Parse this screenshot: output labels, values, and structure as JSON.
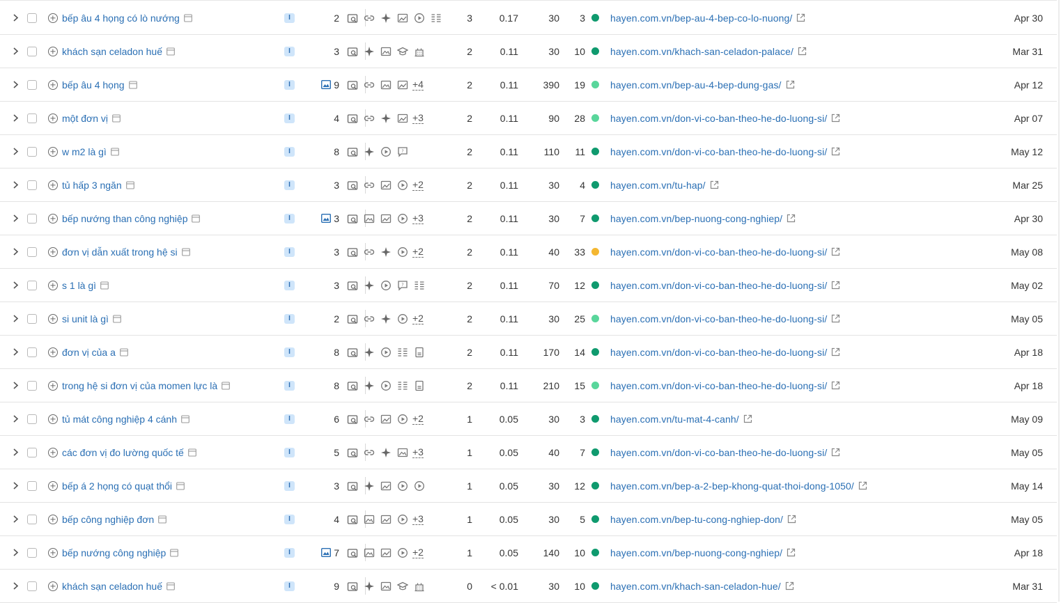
{
  "colors": {
    "kd_dark_green": "#0f9a6e",
    "kd_light_green": "#59d69b",
    "kd_yellow": "#f4b731",
    "link_blue": "#2a6fb4"
  },
  "intent_label": "I",
  "rows": [
    {
      "keyword": "bếp âu 4 họng có lò nướng",
      "image": false,
      "results": "2",
      "features": [
        "link",
        "magic",
        "image-check",
        "play",
        "list"
      ],
      "more": "",
      "volume": "3",
      "share": "0.17",
      "cpc": "30",
      "kd": "3",
      "kd_color": "#0f9a6e",
      "url": "hayen.com.vn/bep-au-4-bep-co-lo-nuong/",
      "date": "Apr 30"
    },
    {
      "keyword": "khách sạn celadon huế",
      "image": false,
      "results": "3",
      "features": [
        "magic",
        "image",
        "graduation",
        "hotel"
      ],
      "more": "",
      "volume": "2",
      "share": "0.11",
      "cpc": "30",
      "kd": "10",
      "kd_color": "#0f9a6e",
      "url": "hayen.com.vn/khach-san-celadon-palace/",
      "date": "Mar 31"
    },
    {
      "keyword": "bếp âu 4 họng",
      "image": true,
      "results": "9",
      "features": [
        "link",
        "image",
        "image-check"
      ],
      "more": "+4",
      "volume": "2",
      "share": "0.11",
      "cpc": "390",
      "kd": "19",
      "kd_color": "#59d69b",
      "url": "hayen.com.vn/bep-au-4-bep-dung-gas/",
      "date": "Apr 12"
    },
    {
      "keyword": "một đơn vị",
      "image": false,
      "results": "4",
      "features": [
        "link",
        "magic",
        "image-check"
      ],
      "more": "+3",
      "volume": "2",
      "share": "0.11",
      "cpc": "90",
      "kd": "28",
      "kd_color": "#59d69b",
      "url": "hayen.com.vn/don-vi-co-ban-theo-he-do-luong-si/",
      "date": "Apr 07"
    },
    {
      "keyword": "w m2 là gì",
      "image": false,
      "results": "8",
      "features": [
        "magic",
        "play",
        "question"
      ],
      "more": "",
      "volume": "2",
      "share": "0.11",
      "cpc": "110",
      "kd": "11",
      "kd_color": "#0f9a6e",
      "url": "hayen.com.vn/don-vi-co-ban-theo-he-do-luong-si/",
      "date": "May 12"
    },
    {
      "keyword": "tủ hấp 3 ngăn",
      "image": false,
      "results": "3",
      "features": [
        "link",
        "image-check",
        "play"
      ],
      "more": "+2",
      "volume": "2",
      "share": "0.11",
      "cpc": "30",
      "kd": "4",
      "kd_color": "#0f9a6e",
      "url": "hayen.com.vn/tu-hap/",
      "date": "Mar 25"
    },
    {
      "keyword": "bếp nướng than công nghiệp",
      "image": true,
      "results": "3",
      "features": [
        "image",
        "image-check",
        "play"
      ],
      "more": "+3",
      "volume": "2",
      "share": "0.11",
      "cpc": "30",
      "kd": "7",
      "kd_color": "#0f9a6e",
      "url": "hayen.com.vn/bep-nuong-cong-nghiep/",
      "date": "Apr 30"
    },
    {
      "keyword": "đơn vị dẫn xuất trong hệ si",
      "image": false,
      "results": "3",
      "features": [
        "link",
        "magic",
        "play"
      ],
      "more": "+2",
      "volume": "2",
      "share": "0.11",
      "cpc": "40",
      "kd": "33",
      "kd_color": "#f4b731",
      "url": "hayen.com.vn/don-vi-co-ban-theo-he-do-luong-si/",
      "date": "May 08"
    },
    {
      "keyword": "s 1 là gì",
      "image": false,
      "results": "3",
      "features": [
        "magic",
        "play",
        "question",
        "list"
      ],
      "more": "",
      "volume": "2",
      "share": "0.11",
      "cpc": "70",
      "kd": "12",
      "kd_color": "#0f9a6e",
      "url": "hayen.com.vn/don-vi-co-ban-theo-he-do-luong-si/",
      "date": "May 02"
    },
    {
      "keyword": "si unit là gì",
      "image": false,
      "results": "2",
      "features": [
        "link",
        "magic",
        "play"
      ],
      "more": "+2",
      "volume": "2",
      "share": "0.11",
      "cpc": "30",
      "kd": "25",
      "kd_color": "#59d69b",
      "url": "hayen.com.vn/don-vi-co-ban-theo-he-do-luong-si/",
      "date": "May 05"
    },
    {
      "keyword": "đơn vị của a",
      "image": false,
      "results": "8",
      "features": [
        "magic",
        "play",
        "list",
        "doc"
      ],
      "more": "",
      "volume": "2",
      "share": "0.11",
      "cpc": "170",
      "kd": "14",
      "kd_color": "#0f9a6e",
      "url": "hayen.com.vn/don-vi-co-ban-theo-he-do-luong-si/",
      "date": "Apr 18"
    },
    {
      "keyword": "trong hệ si đơn vị của momen lực là",
      "image": false,
      "results": "8",
      "features": [
        "magic",
        "play",
        "list",
        "doc"
      ],
      "more": "",
      "volume": "2",
      "share": "0.11",
      "cpc": "210",
      "kd": "15",
      "kd_color": "#59d69b",
      "url": "hayen.com.vn/don-vi-co-ban-theo-he-do-luong-si/",
      "date": "Apr 18"
    },
    {
      "keyword": "tủ mát công nghiệp 4 cánh",
      "image": false,
      "results": "6",
      "features": [
        "link",
        "image-check",
        "play"
      ],
      "more": "+2",
      "volume": "1",
      "share": "0.05",
      "cpc": "30",
      "kd": "3",
      "kd_color": "#0f9a6e",
      "url": "hayen.com.vn/tu-mat-4-canh/",
      "date": "May 09"
    },
    {
      "keyword": "các đơn vị đo lường quốc tế",
      "image": false,
      "results": "5",
      "features": [
        "link",
        "magic",
        "image"
      ],
      "more": "+3",
      "volume": "1",
      "share": "0.05",
      "cpc": "40",
      "kd": "7",
      "kd_color": "#0f9a6e",
      "url": "hayen.com.vn/don-vi-co-ban-theo-he-do-luong-si/",
      "date": "May 05"
    },
    {
      "keyword": "bếp á 2 họng có quạt thổi",
      "image": false,
      "results": "3",
      "features": [
        "magic",
        "image-check",
        "play",
        "play"
      ],
      "more": "",
      "volume": "1",
      "share": "0.05",
      "cpc": "30",
      "kd": "12",
      "kd_color": "#0f9a6e",
      "url": "hayen.com.vn/bep-a-2-bep-khong-quat-thoi-dong-1050/",
      "date": "May 14"
    },
    {
      "keyword": "bếp công nghiệp đơn",
      "image": false,
      "results": "4",
      "features": [
        "image",
        "image-check",
        "play"
      ],
      "more": "+3",
      "volume": "1",
      "share": "0.05",
      "cpc": "30",
      "kd": "5",
      "kd_color": "#0f9a6e",
      "url": "hayen.com.vn/bep-tu-cong-nghiep-don/",
      "date": "May 05"
    },
    {
      "keyword": "bếp nướng công nghiệp",
      "image": true,
      "results": "7",
      "features": [
        "image",
        "image-check",
        "play"
      ],
      "more": "+2",
      "volume": "1",
      "share": "0.05",
      "cpc": "140",
      "kd": "10",
      "kd_color": "#0f9a6e",
      "url": "hayen.com.vn/bep-nuong-cong-nghiep/",
      "date": "Apr 18"
    },
    {
      "keyword": "khách sạn celadon huế",
      "image": false,
      "results": "9",
      "features": [
        "magic",
        "image",
        "graduation",
        "hotel"
      ],
      "more": "",
      "volume": "0",
      "share": "< 0.01",
      "cpc": "30",
      "kd": "10",
      "kd_color": "#0f9a6e",
      "url": "hayen.com.vn/khach-san-celadon-hue/",
      "date": "Mar 31"
    }
  ]
}
